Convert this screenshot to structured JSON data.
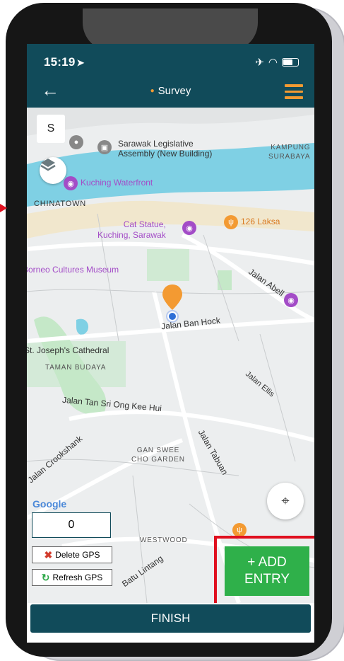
{
  "status_bar": {
    "time": "15:19"
  },
  "header": {
    "title": "Survey"
  },
  "map": {
    "layer_toggle_label": "S",
    "labels": {
      "sarawak_legislative": "Sarawak Legislative\nAssembly (New Building)",
      "kampung_surabaya": "KAMPUNG\nSURABAYA",
      "kuching_waterfront": "Kuching Waterfront",
      "chinatown": "CHINATOWN",
      "cat_statue": "Cat Statue,\nKuching, Sarawak",
      "laksa": "126 Laksa",
      "borneo_museum": "Borneo Cultures Museum",
      "jalan_abell": "Jalan Abell",
      "jalan_ban_hock": "Jalan Ban Hock",
      "st_joseph": "St. Joseph's Cathedral",
      "taman_budaya": "TAMAN BUDAYA",
      "jalan_ellis": "Jalan Ellis",
      "jalan_tan_sri": "Jalan Tan Sri Ong Kee Hui",
      "jalan_crookshank": "Jalan Crookshank",
      "gan_swee": "GAN SWEE\nCHO GARDEN",
      "jalan_tabuan": "Jalan Tabuan",
      "westwood": "WESTWOOD",
      "batu_lintang": "Batu Lintang",
      "google": "Google"
    },
    "entry_count": "0",
    "delete_gps_label": "Delete GPS",
    "refresh_gps_label": "Refresh GPS",
    "add_entry_line1": "+ ADD",
    "add_entry_line2": "ENTRY"
  },
  "footer": {
    "finish_label": "FINISH"
  },
  "colors": {
    "header_bg": "#114b5a",
    "accent_orange": "#f39a32",
    "add_green": "#2fb04a",
    "highlight_red": "#e0101f",
    "river": "#7fd0e4"
  },
  "icons": [
    "location-arrow-icon",
    "airplane-icon",
    "wifi-icon",
    "battery-icon",
    "back-arrow-icon",
    "hamburger-menu-icon",
    "layers-icon",
    "map-pin-icon",
    "my-location-icon",
    "delete-icon",
    "refresh-icon"
  ]
}
